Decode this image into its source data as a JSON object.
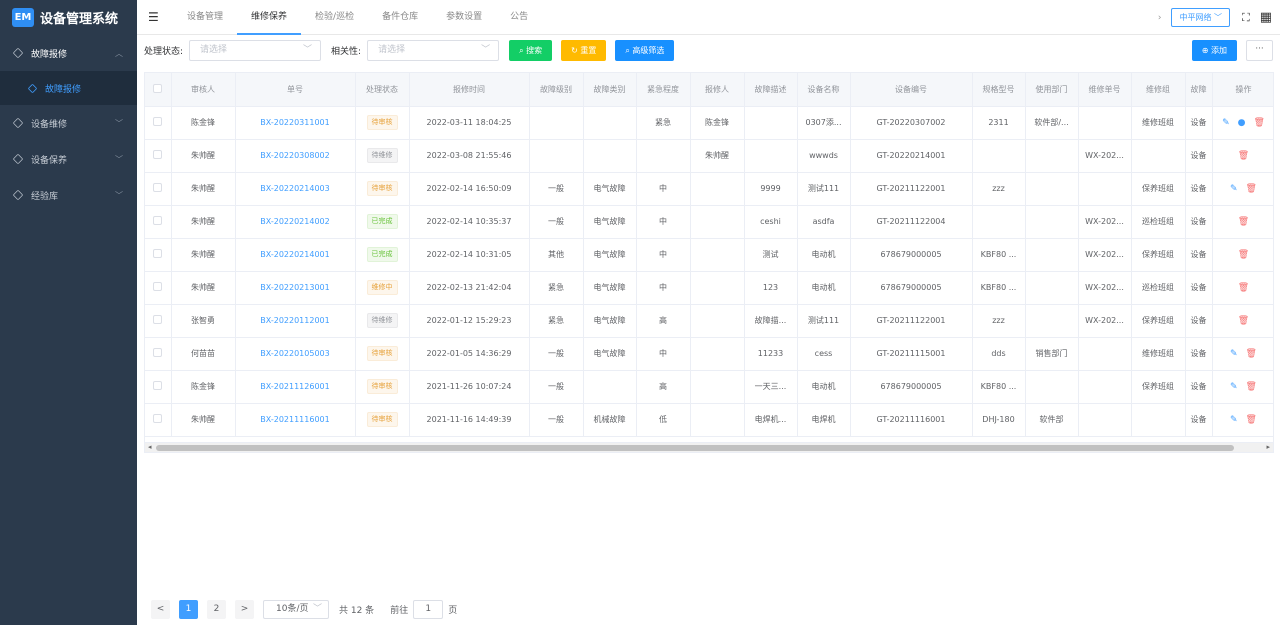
{
  "app": {
    "logo_text": "EM",
    "title": "设备管理系统"
  },
  "sidebar": {
    "items": [
      {
        "label": "故障报修",
        "icon": "cube-icon",
        "open": true
      },
      {
        "label": "设备维修",
        "icon": "cube-icon"
      },
      {
        "label": "设备保养",
        "icon": "cube-icon"
      },
      {
        "label": "经验库",
        "icon": "cube-icon"
      }
    ],
    "sub_items": [
      {
        "label": "故障报修",
        "active": true
      }
    ]
  },
  "topbar": {
    "tabs": [
      {
        "label": "设备管理"
      },
      {
        "label": "维修保养",
        "active": true
      },
      {
        "label": "检验/巡检"
      },
      {
        "label": "备件仓库"
      },
      {
        "label": "参数设置"
      },
      {
        "label": "公告"
      }
    ],
    "network_label": "中平网络"
  },
  "filters": {
    "status_label": "处理状态:",
    "status_placeholder": "请选择",
    "relevance_label": "相关性:",
    "relevance_placeholder": "请选择",
    "search_label": "搜索",
    "reset_label": "重置",
    "advanced_label": "高级筛选",
    "add_label": "添加",
    "more_label": "···"
  },
  "table": {
    "headers": [
      "审核人",
      "单号",
      "处理状态",
      "报修时间",
      "故障级别",
      "故障类别",
      "紧急程度",
      "报修人",
      "故障描述",
      "设备名称",
      "设备编号",
      "规格型号",
      "使用部门",
      "维修单号",
      "维修组",
      "故障",
      "操作"
    ],
    "rows": [
      {
        "auditor": "陈金锋",
        "no": "BX-20220311001",
        "status": "待审核",
        "status_type": "warn",
        "time": "2022-03-11 18:04:25",
        "level": "",
        "category": "",
        "urgency": "紧急",
        "reporter": "陈金锋",
        "desc": "",
        "device": "0307添...",
        "device_no": "GT-20220307002",
        "model": "2311",
        "dept": "软件部/...",
        "repair_no": "",
        "group": "维修班组",
        "fault": "设备",
        "ops": [
          "edit",
          "user",
          "delete"
        ]
      },
      {
        "auditor": "朱帅醒",
        "no": "BX-20220308002",
        "status": "待维修",
        "status_type": "info",
        "time": "2022-03-08 21:55:46",
        "level": "",
        "category": "",
        "urgency": "",
        "reporter": "朱帅醒",
        "desc": "",
        "device": "wwwds",
        "device_no": "GT-20220214001",
        "model": "",
        "dept": "",
        "repair_no": "WX-202...",
        "group": "",
        "fault": "设备",
        "ops": [
          "delete"
        ]
      },
      {
        "auditor": "朱帅醒",
        "no": "BX-20220214003",
        "status": "待审核",
        "status_type": "warn",
        "time": "2022-02-14 16:50:09",
        "level": "一般",
        "category": "电气故障",
        "urgency": "中",
        "reporter": "",
        "desc": "9999",
        "device": "测试111",
        "device_no": "GT-20211122001",
        "model": "zzz",
        "dept": "",
        "repair_no": "",
        "group": "保养班组",
        "fault": "设备",
        "ops": [
          "edit",
          "delete"
        ]
      },
      {
        "auditor": "朱帅醒",
        "no": "BX-20220214002",
        "status": "已完成",
        "status_type": "success",
        "time": "2022-02-14 10:35:37",
        "level": "一般",
        "category": "电气故障",
        "urgency": "中",
        "reporter": "",
        "desc": "ceshi",
        "device": "asdfa",
        "device_no": "GT-20211122004",
        "model": "",
        "dept": "",
        "repair_no": "WX-202...",
        "group": "巡检班组",
        "fault": "设备",
        "ops": [
          "delete"
        ]
      },
      {
        "auditor": "朱帅醒",
        "no": "BX-20220214001",
        "status": "已完成",
        "status_type": "success",
        "time": "2022-02-14 10:31:05",
        "level": "其他",
        "category": "电气故障",
        "urgency": "中",
        "reporter": "",
        "desc": "测试",
        "device": "电动机",
        "device_no": "678679000005",
        "model": "KBF80 ...",
        "dept": "",
        "repair_no": "WX-202...",
        "group": "保养班组",
        "fault": "设备",
        "ops": [
          "delete"
        ]
      },
      {
        "auditor": "朱帅醒",
        "no": "BX-20220213001",
        "status": "维修中",
        "status_type": "warn",
        "time": "2022-02-13 21:42:04",
        "level": "紧急",
        "category": "电气故障",
        "urgency": "中",
        "reporter": "",
        "desc": "123",
        "device": "电动机",
        "device_no": "678679000005",
        "model": "KBF80 ...",
        "dept": "",
        "repair_no": "WX-202...",
        "group": "巡检班组",
        "fault": "设备",
        "ops": [
          "delete"
        ]
      },
      {
        "auditor": "张智勇",
        "no": "BX-20220112001",
        "status": "待维修",
        "status_type": "info",
        "time": "2022-01-12 15:29:23",
        "level": "紧急",
        "category": "电气故障",
        "urgency": "高",
        "reporter": "",
        "desc": "故障描...",
        "device": "测试111",
        "device_no": "GT-20211122001",
        "model": "zzz",
        "dept": "",
        "repair_no": "WX-202...",
        "group": "保养班组",
        "fault": "设备",
        "ops": [
          "delete"
        ]
      },
      {
        "auditor": "何苗苗",
        "no": "BX-20220105003",
        "status": "待审核",
        "status_type": "warn",
        "time": "2022-01-05 14:36:29",
        "level": "一般",
        "category": "电气故障",
        "urgency": "中",
        "reporter": "",
        "desc": "11233",
        "device": "cess",
        "device_no": "GT-20211115001",
        "model": "dds",
        "dept": "销售部门",
        "repair_no": "",
        "group": "维修班组",
        "fault": "设备",
        "ops": [
          "edit",
          "delete"
        ]
      },
      {
        "auditor": "陈金锋",
        "no": "BX-20211126001",
        "status": "待审核",
        "status_type": "warn",
        "time": "2021-11-26 10:07:24",
        "level": "一般",
        "category": "",
        "urgency": "高",
        "reporter": "",
        "desc": "一天三...",
        "device": "电动机",
        "device_no": "678679000005",
        "model": "KBF80 ...",
        "dept": "",
        "repair_no": "",
        "group": "保养班组",
        "fault": "设备",
        "ops": [
          "edit",
          "delete"
        ]
      },
      {
        "auditor": "朱帅醒",
        "no": "BX-20211116001",
        "status": "待审核",
        "status_type": "warn",
        "time": "2021-11-16 14:49:39",
        "level": "一般",
        "category": "机械故障",
        "urgency": "低",
        "reporter": "",
        "desc": "电焊机...",
        "device": "电焊机",
        "device_no": "GT-20211116001",
        "model": "DHJ-180",
        "dept": "软件部",
        "repair_no": "",
        "group": "",
        "fault": "设备",
        "ops": [
          "edit",
          "delete"
        ]
      }
    ]
  },
  "pagination": {
    "prev": "<",
    "pages": [
      "1",
      "2"
    ],
    "current": "1",
    "next": ">",
    "page_size": "10条/页",
    "total": "共 12 条",
    "goto_prefix": "前往",
    "goto_value": "1",
    "goto_suffix": "页"
  }
}
